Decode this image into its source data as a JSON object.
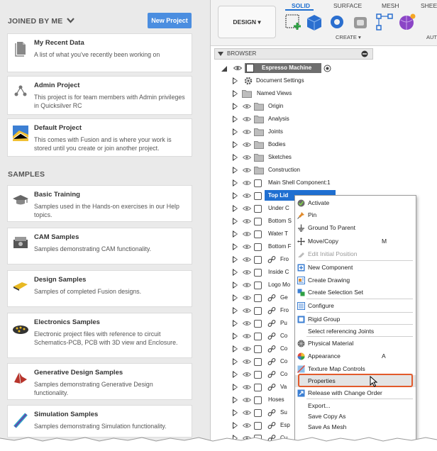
{
  "left": {
    "joined_title": "JOINED BY ME",
    "new_project_label": "New Project",
    "samples_title": "SAMPLES",
    "projects": [
      {
        "title": "My Recent Data",
        "desc": "A list of what you've recently been working on",
        "icon": "document-icon"
      },
      {
        "title": "Admin Project",
        "desc": "This project is for team members with Admin privileges in Quicksilver RC",
        "icon": "network-icon"
      },
      {
        "title": "Default Project",
        "desc": "This comes with Fusion and is where your work is stored until you create or join another project.",
        "icon": "default-project-icon"
      }
    ],
    "samples": [
      {
        "title": "Basic Training",
        "desc": "Samples used in the Hands-on exercises in our Help topics.",
        "icon": "graduation-cap-icon"
      },
      {
        "title": "CAM Samples",
        "desc": "Samples demonstrating CAM functionality.",
        "icon": "cam-part-icon"
      },
      {
        "title": "Design Samples",
        "desc": "Samples of completed Fusion designs.",
        "icon": "design-part-icon"
      },
      {
        "title": "Electronics Samples",
        "desc": "Electronic project files with reference to circuit Schematics-PCB, PCB with 3D view and Enclosure.",
        "icon": "circuit-board-icon"
      },
      {
        "title": "Generative Design Samples",
        "desc": "Samples demonstrating Generative Design functionality.",
        "icon": "generative-part-icon"
      },
      {
        "title": "Simulation Samples",
        "desc": "Samples demonstrating Simulation functionality.",
        "icon": "simulation-part-icon"
      }
    ]
  },
  "toolbar": {
    "workspace": "DESIGN",
    "tabs": [
      "SOLID",
      "SURFACE",
      "MESH",
      "SHEET"
    ],
    "create_label": "CREATE",
    "auto_label": "AUT"
  },
  "browser": {
    "header": "BROWSER",
    "root": "Espresso Machine",
    "items": [
      {
        "label": "Document Settings",
        "kind": "gear"
      },
      {
        "label": "Named Views",
        "kind": "folder"
      },
      {
        "label": "Origin",
        "kind": "folder"
      },
      {
        "label": "Analysis",
        "kind": "folder"
      },
      {
        "label": "Joints",
        "kind": "folder"
      },
      {
        "label": "Bodies",
        "kind": "folder"
      },
      {
        "label": "Sketches",
        "kind": "folder"
      },
      {
        "label": "Construction",
        "kind": "folder"
      },
      {
        "label": "Main Shell Component:1",
        "kind": "component"
      },
      {
        "label": "Top Lid",
        "kind": "component-selected"
      },
      {
        "label": "Under C",
        "kind": "component"
      },
      {
        "label": "Bottom S",
        "kind": "component"
      },
      {
        "label": "Water T",
        "kind": "component"
      },
      {
        "label": "Bottom F",
        "kind": "component"
      },
      {
        "label": "Fro",
        "kind": "linked"
      },
      {
        "label": "Inside C",
        "kind": "component"
      },
      {
        "label": "Logo Mo",
        "kind": "component"
      },
      {
        "label": "Ge",
        "kind": "linked"
      },
      {
        "label": "Fro",
        "kind": "linked"
      },
      {
        "label": "Pu",
        "kind": "linked"
      },
      {
        "label": "Co",
        "kind": "linked"
      },
      {
        "label": "Co",
        "kind": "linked"
      },
      {
        "label": "Co",
        "kind": "linked"
      },
      {
        "label": "Co",
        "kind": "linked"
      },
      {
        "label": "Va",
        "kind": "linked"
      },
      {
        "label": "Hoses",
        "kind": "component"
      },
      {
        "label": "Su",
        "kind": "linked"
      },
      {
        "label": "Esp",
        "kind": "linked"
      },
      {
        "label": "Cu",
        "kind": "linked"
      }
    ]
  },
  "context_menu": {
    "items": [
      {
        "label": "Activate",
        "icon": "activate-check-icon",
        "shortcut": ""
      },
      {
        "label": "Pin",
        "icon": "pin-icon",
        "shortcut": ""
      },
      {
        "label": "Ground To Parent",
        "icon": "ground-icon",
        "shortcut": ""
      },
      {
        "label": "Move/Copy",
        "icon": "move-icon",
        "shortcut": "M"
      },
      {
        "label": "Edit Initial Position",
        "icon": "edit-position-icon",
        "shortcut": "",
        "disabled": true
      },
      {
        "label": "New Component",
        "icon": "new-component-icon",
        "shortcut": ""
      },
      {
        "label": "Create Drawing",
        "icon": "drawing-icon",
        "shortcut": ""
      },
      {
        "label": "Create Selection Set",
        "icon": "selection-set-icon",
        "shortcut": ""
      },
      {
        "label": "Configure",
        "icon": "configure-icon",
        "shortcut": ""
      },
      {
        "label": "Rigid Group",
        "icon": "rigid-group-icon",
        "shortcut": ""
      },
      {
        "label": "Select referencing Joints",
        "icon": "",
        "shortcut": ""
      },
      {
        "label": "Physical Material",
        "icon": "material-icon",
        "shortcut": ""
      },
      {
        "label": "Appearance",
        "icon": "appearance-icon",
        "shortcut": "A"
      },
      {
        "label": "Texture Map Controls",
        "icon": "texture-icon",
        "shortcut": ""
      },
      {
        "label": "Properties",
        "icon": "",
        "shortcut": ""
      },
      {
        "label": "Release with Change Order",
        "icon": "release-icon",
        "shortcut": ""
      },
      {
        "label": "Export...",
        "icon": "",
        "shortcut": ""
      },
      {
        "label": "Save Copy As",
        "icon": "",
        "shortcut": ""
      },
      {
        "label": "Save As Mesh",
        "icon": "",
        "shortcut": ""
      }
    ]
  },
  "colors": {
    "accent": "#1e6fd0",
    "highlight_box": "#e25a2b",
    "new_project_bg": "#4b8ee0"
  }
}
